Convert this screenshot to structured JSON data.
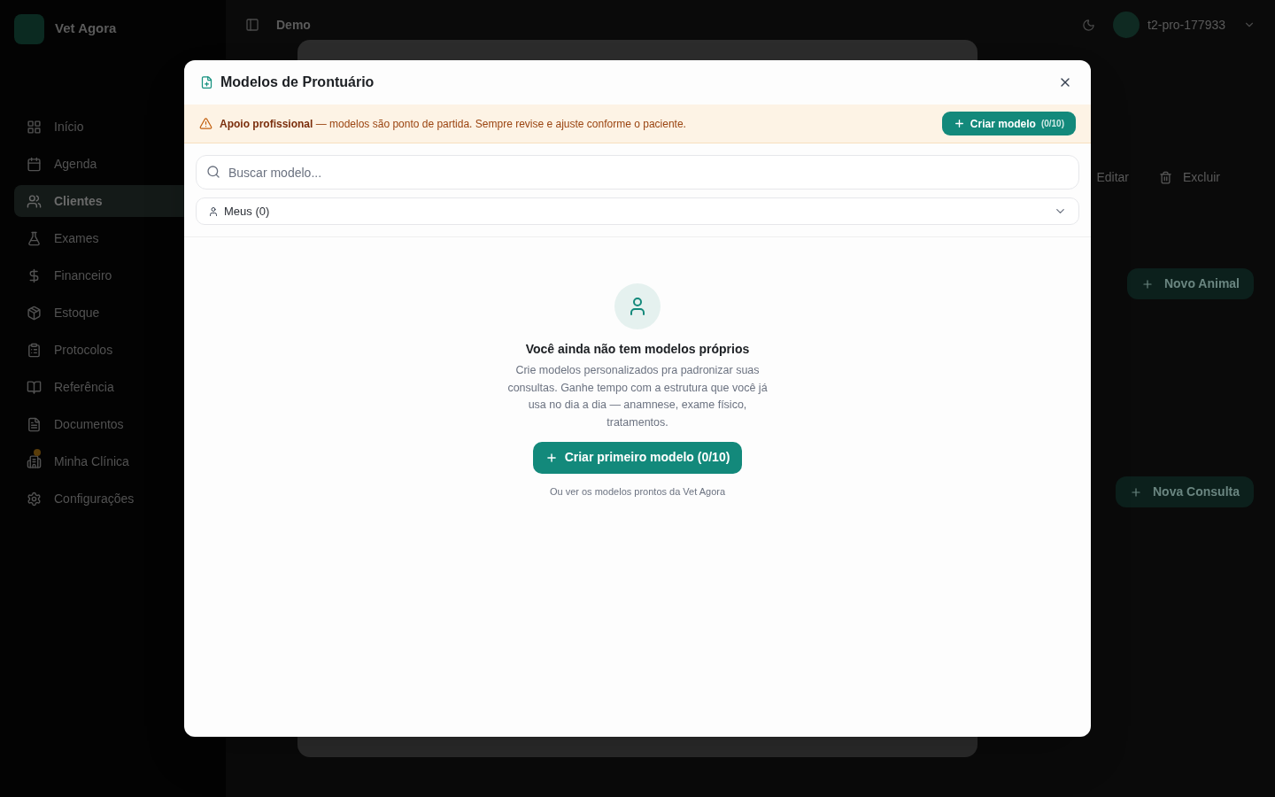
{
  "sidebar": {
    "brand": "Vet Agora",
    "items": [
      {
        "label": "Início",
        "selected": false,
        "badge": false
      },
      {
        "label": "Agenda",
        "selected": false,
        "badge": false
      },
      {
        "label": "Clientes",
        "selected": true,
        "badge": false
      },
      {
        "label": "Exames",
        "selected": false,
        "badge": false
      },
      {
        "label": "Financeiro",
        "selected": false,
        "badge": false
      },
      {
        "label": "Estoque",
        "selected": false,
        "badge": false
      },
      {
        "label": "Protocolos",
        "selected": false,
        "badge": false
      },
      {
        "label": "Referência",
        "selected": false,
        "badge": false
      },
      {
        "label": "Documentos",
        "selected": false,
        "badge": false
      },
      {
        "label": "Minha Clínica",
        "selected": false,
        "badge": true
      },
      {
        "label": "Configurações",
        "selected": false,
        "badge": false
      }
    ]
  },
  "topbar": {
    "title": "Demo",
    "user": "t2-pro-177933"
  },
  "page": {
    "actions": [
      {
        "label": "Editar"
      },
      {
        "label": "Excluir"
      }
    ],
    "buttons": [
      "Novo Animal",
      "Nova Consulta"
    ]
  },
  "dialog": {
    "title": "Modelos de Prontuário",
    "notice": {
      "text": "**Apoio profissional** — modelos são ponto de partida. Sempre revise e ajuste conforme o paciente.",
      "button": {
        "label": "Criar modelo",
        "count": "(0/10)"
      }
    },
    "search": {
      "placeholder": "Buscar modelo..."
    },
    "filter": {
      "value": "Meus (0)"
    },
    "empty_state": {
      "title": "Você ainda não tem modelos próprios",
      "description": "Crie modelos personalizados pra padronizar suas consultas. Ganhe tempo com a estrutura que você já usa no dia a dia — anamnese, exame físico, tratamentos.",
      "button": "Criar primeiro modelo (0/10)",
      "link": "Ou ver os modelos prontos da Vet Agora"
    }
  }
}
